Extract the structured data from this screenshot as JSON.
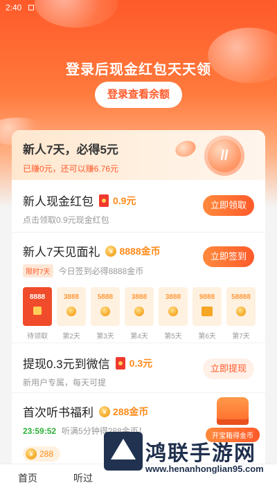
{
  "status_bar": {
    "time": "2:40"
  },
  "hero": {
    "title": "登录后现金红包天天领",
    "login_button": "登录查看余额"
  },
  "newbie_banner": {
    "title": "新人7天，必得5元",
    "subtitle": "已赚0元，还可以赚6.76元"
  },
  "tasks": {
    "cash_packet": {
      "title": "新人现金红包",
      "amount": "0.9元",
      "desc": "点击领取0.9元现金红包",
      "button": "立即领取"
    },
    "seven_day": {
      "title": "新人7天见面礼",
      "amount": "8888金币",
      "tag": "限时7天",
      "desc": "今日签到必得8888金币",
      "button": "立即签到",
      "days": [
        {
          "value": "8888",
          "label": "待领取",
          "state": "active"
        },
        {
          "value": "3888",
          "label": "第2天",
          "state": "normal"
        },
        {
          "value": "5888",
          "label": "第3天",
          "state": "normal"
        },
        {
          "value": "3888",
          "label": "第4天",
          "state": "normal"
        },
        {
          "value": "3888",
          "label": "第5天",
          "state": "normal"
        },
        {
          "value": "9888",
          "label": "第6天",
          "state": "gift"
        },
        {
          "value": "58888",
          "label": "第7天",
          "state": "trophy"
        }
      ]
    },
    "withdraw": {
      "title": "提现0.3元到微信",
      "amount": "0.3元",
      "desc": "新用户专属，每天可提",
      "button": "立即提现"
    },
    "listen": {
      "title": "首次听书福利",
      "amount": "288金币",
      "timer": "23:59:52",
      "desc": "听满5分钟得288金币！",
      "pill": "288",
      "treasure_label": "开宝箱得金币"
    }
  },
  "tabbar": {
    "tab1": "首页",
    "tab2": "听过"
  },
  "watermark": {
    "title": "鸿联手游网",
    "url": "www.henanhonglian95.com"
  }
}
